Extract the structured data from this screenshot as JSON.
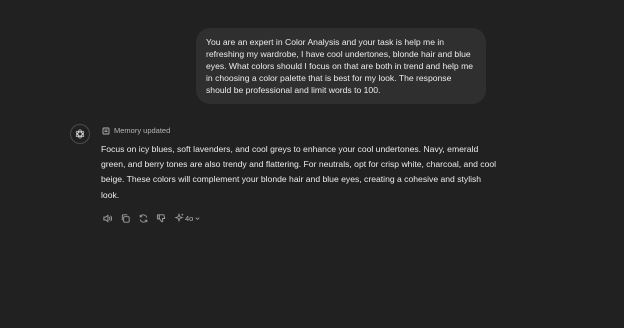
{
  "user_message": {
    "text": "You are an expert in Color Analysis and your task is help me in refreshing my wardrobe, I have cool undertones, blonde hair and blue eyes. What colors should I focus on that are both in trend and help me in choosing a color palette that is best for my look. The response should be professional and limit words to 100."
  },
  "assistant_message": {
    "avatar_icon": "openai-logo-icon",
    "memory_status": "Memory updated",
    "memory_icon": "memory-icon",
    "text": "Focus on icy blues, soft lavenders, and cool greys to enhance your cool undertones. Navy, emerald green, and berry tones are also trendy and flattering. For neutrals, opt for crisp white, charcoal, and cool beige. These colors will complement your blonde hair and blue eyes, creating a cohesive and stylish look."
  },
  "actions": {
    "icons": [
      "read-aloud-icon",
      "copy-icon",
      "regenerate-icon",
      "thumbs-down-icon",
      "sparkle-icon",
      "chevron-down-icon"
    ],
    "model_label": "4o"
  },
  "colors": {
    "background": "#212121",
    "user_bubble": "#2f2f2f",
    "text": "#ececec",
    "muted_text": "#b4b4b4"
  }
}
